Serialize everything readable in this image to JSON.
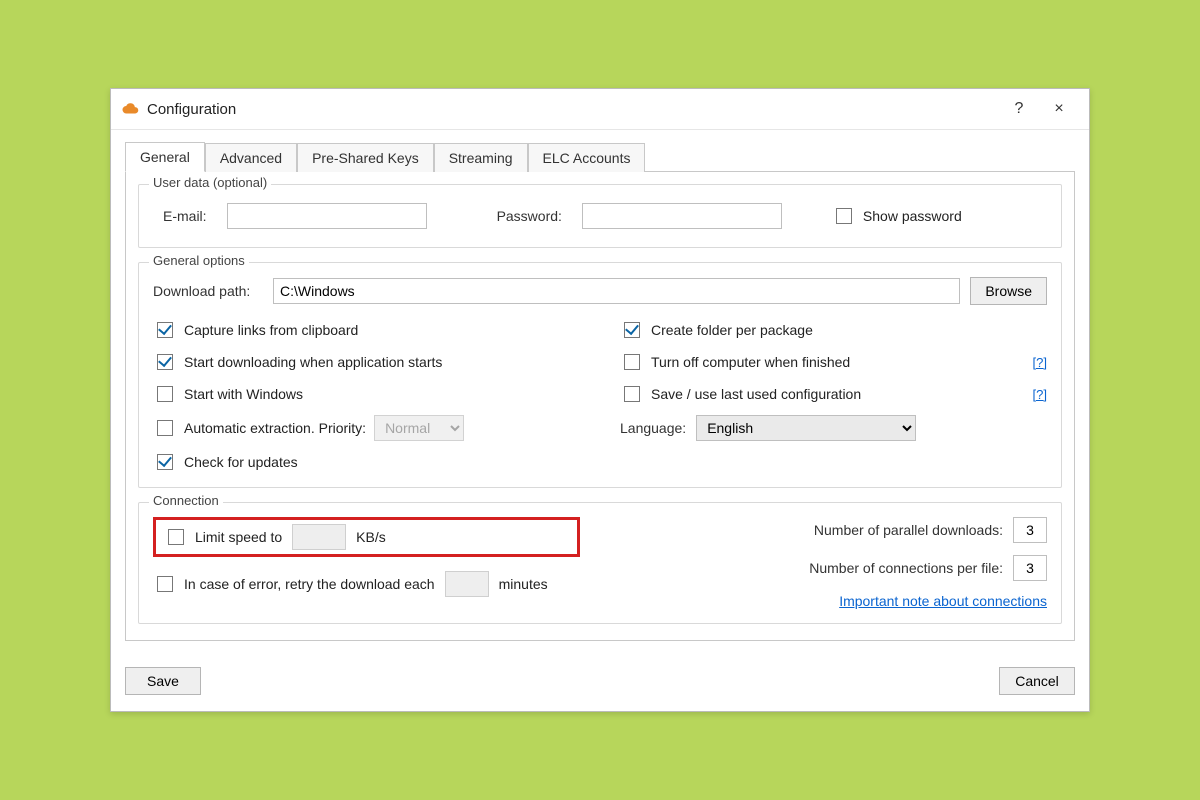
{
  "window": {
    "title": "Configuration",
    "help_label": "?",
    "close_label": "×"
  },
  "tabs": [
    {
      "label": "General",
      "active": true
    },
    {
      "label": "Advanced",
      "active": false
    },
    {
      "label": "Pre-Shared Keys",
      "active": false
    },
    {
      "label": "Streaming",
      "active": false
    },
    {
      "label": "ELC Accounts",
      "active": false
    }
  ],
  "user_data": {
    "legend": "User data (optional)",
    "email_label": "E-mail:",
    "email_value": "",
    "password_label": "Password:",
    "password_value": "",
    "show_password_label": "Show password",
    "show_password_checked": false
  },
  "general_options": {
    "legend": "General options",
    "download_path_label": "Download path:",
    "download_path_value": "C:\\Windows",
    "browse_label": "Browse",
    "left_checks": [
      {
        "label": "Capture links from clipboard",
        "checked": true
      },
      {
        "label": "Start downloading when application starts",
        "checked": true
      },
      {
        "label": "Start with Windows",
        "checked": false
      },
      {
        "label": "Automatic extraction. Priority:",
        "checked": false,
        "has_priority": true
      },
      {
        "label": "Check for updates",
        "checked": true
      }
    ],
    "priority_value": "Normal",
    "right_checks": [
      {
        "label": "Create folder per package",
        "checked": true,
        "help": false
      },
      {
        "label": "Turn off computer when finished",
        "checked": false,
        "help": true
      },
      {
        "label": "Save / use last used configuration",
        "checked": false,
        "help": true
      }
    ],
    "language_label": "Language:",
    "language_value": "English",
    "help_label": "[?]"
  },
  "connection": {
    "legend": "Connection",
    "limit_speed_label": "Limit speed to",
    "limit_speed_checked": false,
    "limit_speed_value": "",
    "limit_speed_unit": "KB/s",
    "retry_label": "In case of error, retry the download each",
    "retry_checked": false,
    "retry_value": "",
    "retry_unit": "minutes",
    "parallel_label": "Number of parallel downloads:",
    "parallel_value": "3",
    "connections_label": "Number of connections per file:",
    "connections_value": "3",
    "note_link": "Important note about connections"
  },
  "footer": {
    "save_label": "Save",
    "cancel_label": "Cancel"
  }
}
